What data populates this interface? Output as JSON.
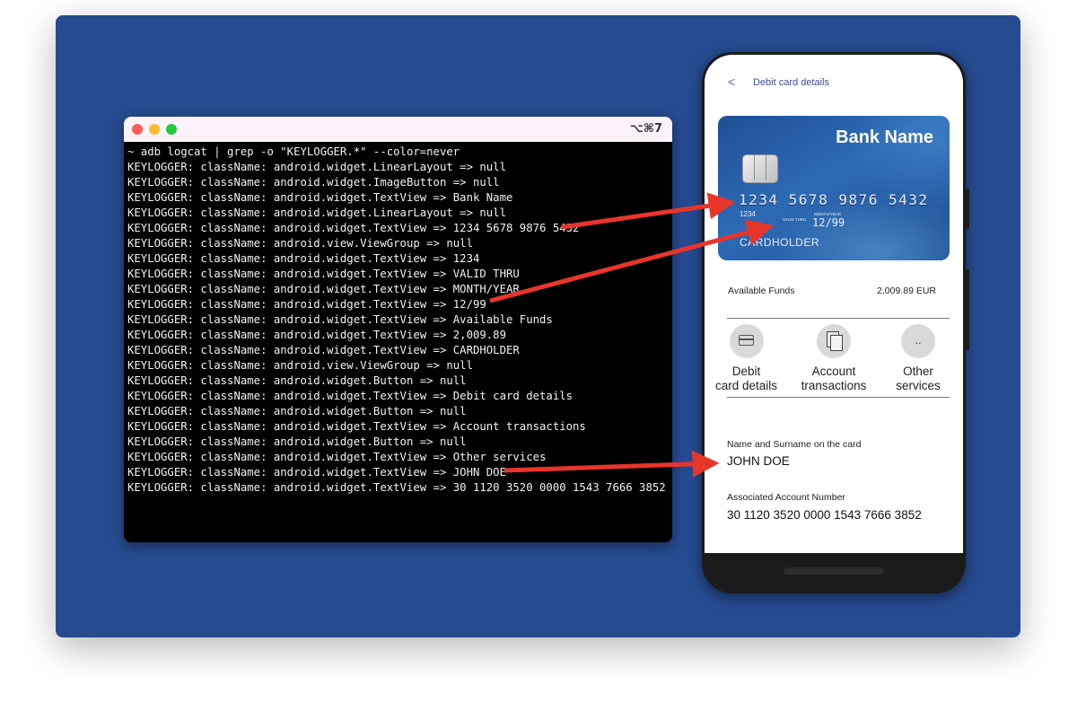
{
  "terminal": {
    "shortcut": "⌥⌘7",
    "lines": [
      "~ adb logcat | grep -o \"KEYLOGGER.*\" --color=never",
      "KEYLOGGER: className: android.widget.LinearLayout => null",
      "KEYLOGGER: className: android.widget.ImageButton => null",
      "KEYLOGGER: className: android.widget.TextView => Bank Name",
      "KEYLOGGER: className: android.widget.LinearLayout => null",
      "KEYLOGGER: className: android.widget.TextView => 1234 5678 9876 5432",
      "KEYLOGGER: className: android.view.ViewGroup => null",
      "KEYLOGGER: className: android.widget.TextView => 1234",
      "KEYLOGGER: className: android.widget.TextView => VALID THRU",
      "KEYLOGGER: className: android.widget.TextView => MONTH/YEAR",
      "KEYLOGGER: className: android.widget.TextView => 12/99",
      "KEYLOGGER: className: android.widget.TextView => Available Funds",
      "KEYLOGGER: className: android.widget.TextView => 2,009.89",
      "KEYLOGGER: className: android.widget.TextView => CARDHOLDER",
      "KEYLOGGER: className: android.view.ViewGroup => null",
      "KEYLOGGER: className: android.widget.Button => null",
      "KEYLOGGER: className: android.widget.TextView => Debit card details",
      "KEYLOGGER: className: android.widget.Button => null",
      "KEYLOGGER: className: android.widget.TextView => Account transactions",
      "KEYLOGGER: className: android.widget.Button => null",
      "KEYLOGGER: className: android.widget.TextView => Other services",
      "KEYLOGGER: className: android.widget.TextView => JOHN DOE",
      "KEYLOGGER: className: android.widget.TextView => 30 1120 3520 0000 1543 7666 3852"
    ]
  },
  "phone": {
    "back_label": "<",
    "title": "Debit card details",
    "card": {
      "bank_name": "Bank Name",
      "number": "1234 5678 9876 5432",
      "small_number": "1234",
      "valid_thru": "VALID THRU",
      "month_year": "MONTH/YEAR",
      "expiry": "12/99",
      "holder": "CARDHOLDER"
    },
    "funds_label": "Available Funds",
    "funds_value": "2,009.89 EUR",
    "actions": [
      {
        "line1": "Debit",
        "line2": "card details",
        "icon": "credit-card-icon"
      },
      {
        "line1": "Account",
        "line2": "transactions",
        "icon": "documents-icon"
      },
      {
        "line1": "Other",
        "line2": "services",
        "icon": "more-icon",
        "glyph": ".."
      }
    ],
    "name_label": "Name and Surname on the card",
    "name_value": "JOHN DOE",
    "account_label": "Associated Account Number",
    "account_value": "30 1120 3520 0000 1543 7666 3852"
  },
  "colors": {
    "background_panel": "#274b91",
    "arrow": "#e8352b",
    "terminal_bg": "#000000",
    "title_accent": "#3e4a98"
  }
}
